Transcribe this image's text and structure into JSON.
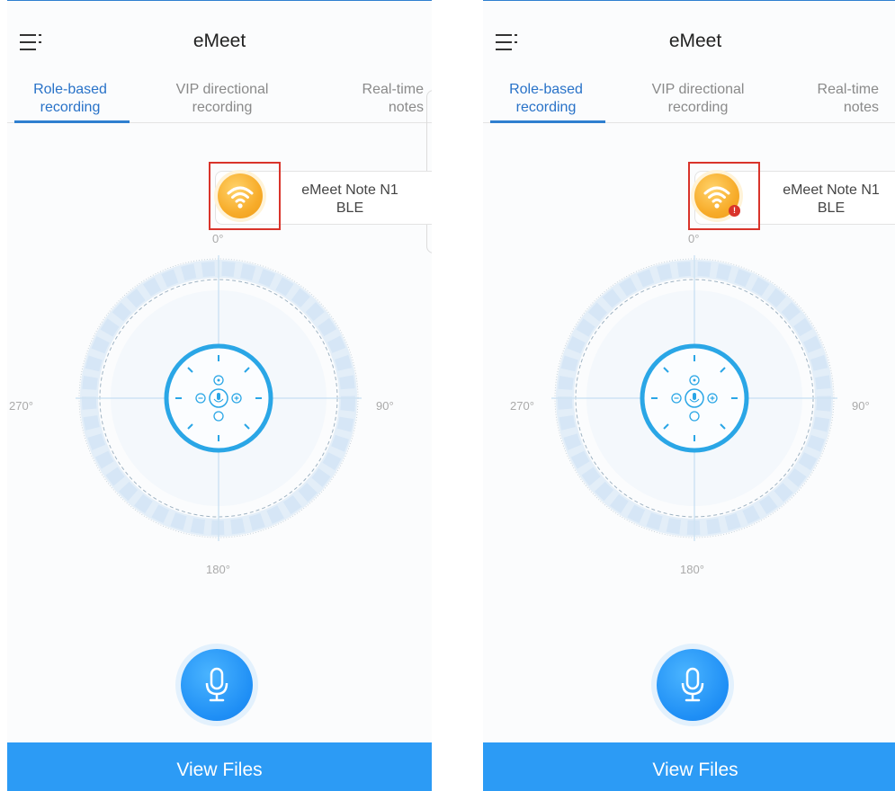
{
  "screens": [
    {
      "app_title": "eMeet",
      "tabs": [
        {
          "line1": "Role-based",
          "line2": "recording"
        },
        {
          "line1": "VIP directional",
          "line2": "recording"
        },
        {
          "line1": "Real-time",
          "line2": "notes"
        }
      ],
      "active_tab": 0,
      "device": {
        "name": "eMeet Note N1",
        "connection": "BLE",
        "alert": ""
      },
      "dial": {
        "top": "0°",
        "right": "90°",
        "bottom": "180°",
        "left": "270°"
      },
      "footer_button": "View Files"
    },
    {
      "app_title": "eMeet",
      "tabs": [
        {
          "line1": "Role-based",
          "line2": "recording"
        },
        {
          "line1": "VIP directional",
          "line2": "recording"
        },
        {
          "line1": "Real-time",
          "line2": "notes"
        }
      ],
      "active_tab": 0,
      "device": {
        "name": "eMeet Note N1",
        "connection": "BLE",
        "alert": "!"
      },
      "dial": {
        "top": "0°",
        "right": "90°",
        "bottom": "180°",
        "left": "270°"
      },
      "footer_button": "View Files"
    }
  ],
  "colors": {
    "accent": "#2f7fd0",
    "wifi": "#f7ac2a",
    "highlight": "#d9342b",
    "mic": "#1e8ef5",
    "footer": "#2c9bf5"
  },
  "icons": {
    "menu": "menu-icon",
    "wifi": "wifi-icon",
    "mic": "microphone-icon"
  }
}
